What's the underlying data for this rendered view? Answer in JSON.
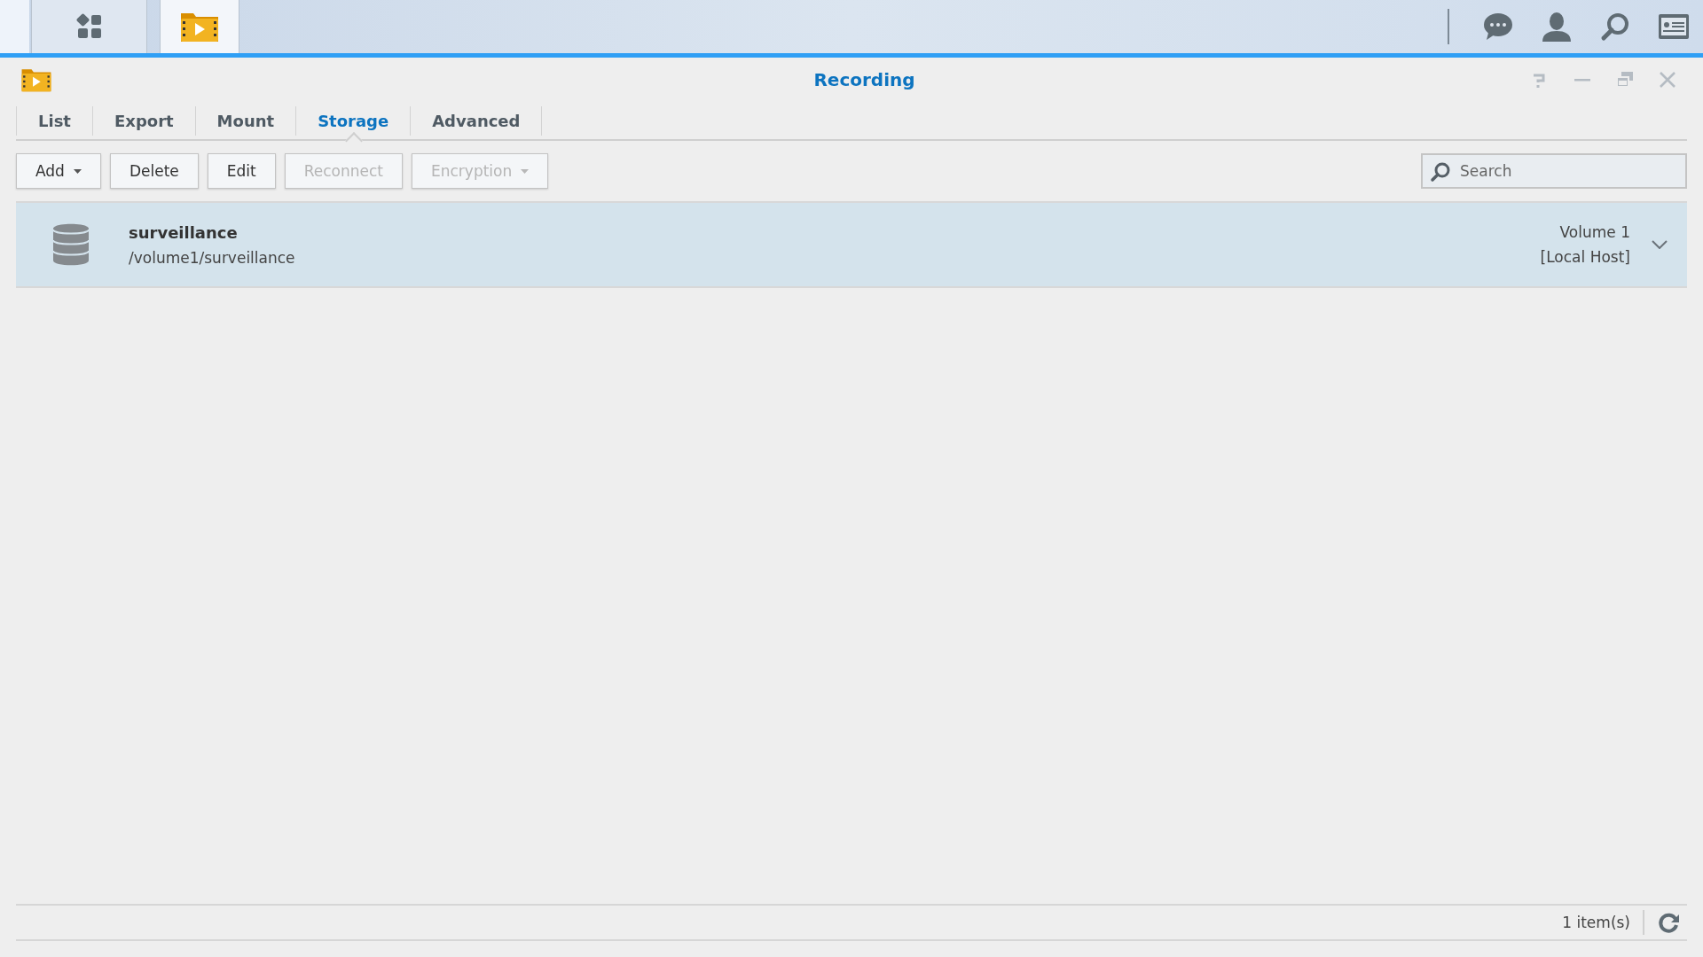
{
  "taskbar": {
    "apps": [
      {
        "kind": "dashboard",
        "selected": false
      },
      {
        "kind": "recording",
        "selected": true
      }
    ]
  },
  "window": {
    "title": "Recording"
  },
  "tabs": [
    {
      "label": "List",
      "selected": false
    },
    {
      "label": "Export",
      "selected": false
    },
    {
      "label": "Mount",
      "selected": false
    },
    {
      "label": "Storage",
      "selected": true
    },
    {
      "label": "Advanced",
      "selected": false
    }
  ],
  "toolbar": {
    "buttons": [
      {
        "label": "Add",
        "disabled": false,
        "menu": true
      },
      {
        "label": "Delete",
        "disabled": false,
        "menu": false
      },
      {
        "label": "Edit",
        "disabled": false,
        "menu": false
      },
      {
        "label": "Reconnect",
        "disabled": true,
        "menu": false
      },
      {
        "label": "Encryption",
        "disabled": true,
        "menu": true
      }
    ],
    "search": {
      "placeholder": "Search"
    }
  },
  "storage": [
    {
      "name": "surveillance",
      "path": "/volume1/surveillance",
      "volume": "Volume 1",
      "host": "[Local Host]",
      "selected": true
    }
  ],
  "status_bar": {
    "count": "1 item(s)"
  }
}
